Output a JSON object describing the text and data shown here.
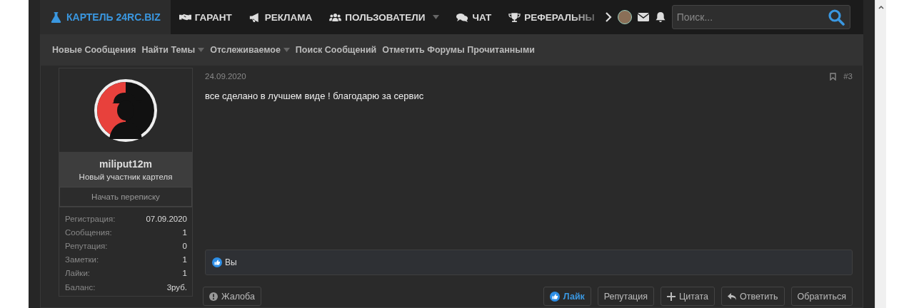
{
  "nav": {
    "logo": {
      "label": "КАРТЕЛЬ 24RC.BIZ",
      "selected": true
    },
    "items": [
      {
        "label": "ГАРАНТ",
        "dropdown": false
      },
      {
        "label": "РЕКЛАМА",
        "dropdown": false
      },
      {
        "label": "ПОЛЬЗОВАТЕЛИ",
        "dropdown": true
      },
      {
        "label": "ЧАТ",
        "dropdown": false
      },
      {
        "label": "РЕФЕРАЛЬНЫ",
        "dropdown": false
      }
    ],
    "search": {
      "placeholder": "Поиск..."
    }
  },
  "subnav": [
    {
      "label": "Новые Сообщения",
      "dropdown": false
    },
    {
      "label": "Найти Темы",
      "dropdown": true
    },
    {
      "label": "Отслеживаемое",
      "dropdown": true
    },
    {
      "label": "Поиск Сообщений",
      "dropdown": false
    },
    {
      "label": "Отметить Форумы Прочитанными",
      "dropdown": false
    }
  ],
  "post": {
    "user": {
      "name": "miliput12m",
      "title": "Новый участник картеля",
      "message_button": "Начать переписку",
      "stats": [
        {
          "label": "Регистрация:",
          "value": "07.09.2020"
        },
        {
          "label": "Сообщения:",
          "value": "1"
        },
        {
          "label": "Репутация:",
          "value": "0"
        },
        {
          "label": "Заметки:",
          "value": "1"
        },
        {
          "label": "Лайки:",
          "value": "1"
        },
        {
          "label": "Баланс:",
          "value": "3руб."
        }
      ]
    },
    "date": "24.09.2020",
    "number": "#3",
    "text": "все сделано в лучшем виде ! благодарю за сервис",
    "reactions": "Вы",
    "report": "Жалоба",
    "actions": [
      {
        "label": "Лайк",
        "kind": "like",
        "selected": true
      },
      {
        "label": "Репутация",
        "kind": "plain",
        "selected": false
      },
      {
        "label": "Цитата",
        "kind": "quote",
        "selected": false
      },
      {
        "label": "Ответить",
        "kind": "reply",
        "selected": false
      },
      {
        "label": "Обратиться",
        "kind": "plain",
        "selected": false
      }
    ]
  }
}
